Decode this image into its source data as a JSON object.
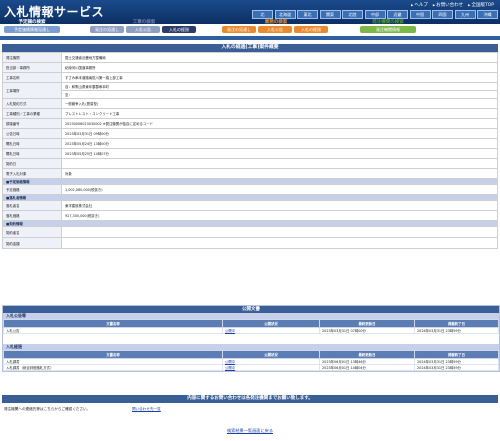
{
  "header": {
    "title": "入札情報サービス",
    "links": [
      "ヘルプ",
      "お問い合わせ",
      "全国版TOP"
    ],
    "regions": [
      "北",
      "北海道",
      "東北",
      "関東",
      "北陸",
      "中部",
      "近畿",
      "中国",
      "四国",
      "九州",
      "沖縄"
    ]
  },
  "nav": {
    "groups": [
      {
        "caption": "予定調の検索",
        "buttons": [
          "予定価格情報見通し"
        ],
        "color": "#7a9ed0"
      },
      {
        "caption": "工事の検索",
        "buttons": [
          "発注の見通し",
          "入札公告",
          "入札の経過"
        ],
        "color": "#6f7fa8"
      },
      {
        "caption": "業務の検索",
        "buttons": [
          "発注の見通し",
          "入札公告",
          "入札の経過"
        ],
        "color": "#e88a2e"
      },
      {
        "caption": "発注機関の検索",
        "buttons": [
          "発注機関情報"
        ],
        "color": "#7ab84a"
      }
    ]
  },
  "page_title": "入札の経過(工事)案件概要",
  "details": {
    "rows": [
      {
        "label": "発注機関",
        "value": "国土交通省近畿地方整備局"
      },
      {
        "label": "担当部・事務所",
        "value": "紀南河川国道事務所"
      },
      {
        "label": "工事名称",
        "value": "すさみ串本道路南陰川第一橋上部工事"
      },
      {
        "label": "工事場所",
        "value": "自：和歌山県東牟婁郡串本町",
        "value2": "至："
      },
      {
        "label": "入札契約方式",
        "value": "一般競争入札(簡易型)"
      },
      {
        "label": "工事種別／工事の業種",
        "value": "プレストレスト・コンクリート工事"
      },
      {
        "label": "調達番号",
        "value": "20230006023030002        ※発注機関が独自に定めるコード"
      },
      {
        "label": "公告日時",
        "value": "2023年03月31日 09時00分"
      },
      {
        "label": "開札日時",
        "value": "2023年05月24日 13時00分"
      },
      {
        "label": "開札日時",
        "value": "2023年05月25日 14時07分"
      },
      {
        "label": "契約日",
        "value": ""
      },
      {
        "label": "電子入札対象",
        "value": "対象"
      }
    ],
    "sections": {
      "estimate": "■予定価格情報",
      "estimate_label": "予定価格",
      "estimate_value": "1,002,080,000(税抜き)",
      "award": "■落札者情報",
      "award_rows": [
        {
          "label": "落札者名",
          "value": "東洋建設株式会社"
        },
        {
          "label": "落札価格",
          "value": "927,300,000(税抜き)"
        }
      ],
      "contract": "■契約情報",
      "contract_rows": [
        {
          "label": "契約者名",
          "value": ""
        },
        {
          "label": "契約金額",
          "value": ""
        }
      ]
    }
  },
  "files": {
    "title": "公開文書",
    "columns": [
      "文書名称",
      "公開状況",
      "最終更新日",
      "掲載終了日"
    ],
    "groups": [
      {
        "name": "入札公告等",
        "rows": [
          {
            "doc": "入札公告",
            "status": "公開中",
            "updated": "2023年03月31日 07時00分",
            "end": "2024年03月31日 23時59分"
          }
        ]
      },
      {
        "name": "入札経過",
        "rows": [
          {
            "doc": "入札調書",
            "status": "公開中",
            "updated": "2023年06月01日 13時46分",
            "end": "2024年03月31日 23時59分"
          },
          {
            "doc": "入札調書（総合評価落札方式）",
            "status": "公開中",
            "updated": "2023年06月01日 14時04分",
            "end": "2024年03月31日 23時59分"
          }
        ]
      }
    ]
  },
  "inquiry": {
    "title": "内容に関するお問い合わせは各発注機関までお願い致します。",
    "text": "発注機関への連絡先等はこちらからご確認ください。",
    "link": "問い合わせ先一覧"
  },
  "footer": {
    "back": "検索結果一覧画面に戻る"
  }
}
